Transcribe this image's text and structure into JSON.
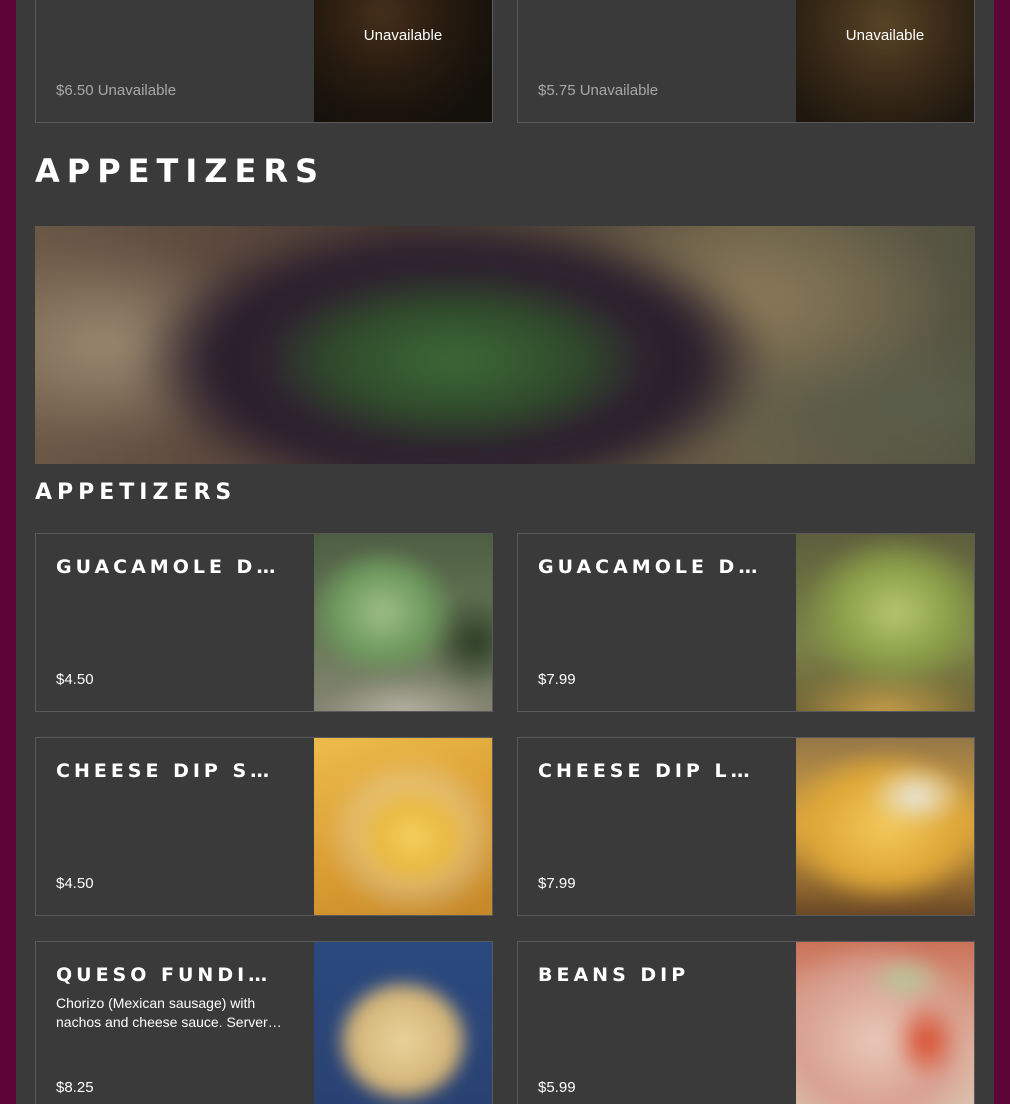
{
  "top_items": [
    {
      "price": "$6.50",
      "status": "Unavailable",
      "overlay": "Unavailable"
    },
    {
      "price": "$5.75",
      "status": "Unavailable",
      "overlay": "Unavailable"
    }
  ],
  "section": {
    "title": "APPETIZERS",
    "subtitle": "APPETIZERS"
  },
  "items": [
    {
      "name": "GUACAMOLE DIP SMALL",
      "price": "$4.50",
      "desc": ""
    },
    {
      "name": "GUACAMOLE DIP LARGE",
      "price": "$7.99",
      "desc": ""
    },
    {
      "name": "CHEESE DIP SMALL",
      "price": "$4.50",
      "desc": ""
    },
    {
      "name": "CHEESE DIP LARGE",
      "price": "$7.99",
      "desc": ""
    },
    {
      "name": "QUESO FUNDIDO",
      "price": "$8.25",
      "desc": "Chorizo (Mexican sausage) with nachos and cheese sauce. Server…"
    },
    {
      "name": "BEANS DIP",
      "price": "$5.99",
      "desc": ""
    }
  ],
  "colors": {
    "page_background": "#5e0538",
    "panel_background": "#3a3a3a",
    "card_border": "#5a5a5a",
    "text": "#ffffff",
    "unavailable_text": "#a8a8a8"
  }
}
